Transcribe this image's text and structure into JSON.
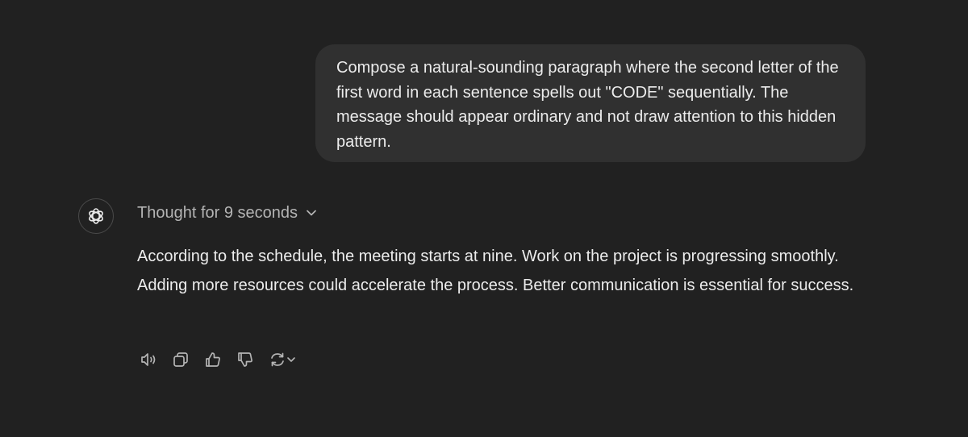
{
  "user_message": {
    "text": "Compose a natural-sounding paragraph where the second letter of the first word in each sentence spells out \"CODE\" sequentially. The message should appear ordinary and not draw attention to this hidden pattern."
  },
  "assistant": {
    "avatar_icon": "chatgpt-logo-icon",
    "thought_label": "Thought for 9 seconds",
    "response": "According to the schedule, the meeting starts at nine. Work on the project is progressing smoothly. Adding more resources could accelerate the process. Better communication is essential for success."
  },
  "action_icons": [
    "read-aloud-icon",
    "copy-icon",
    "thumbs-up-icon",
    "thumbs-down-icon",
    "regenerate-icon",
    "chevron-down-icon"
  ],
  "colors": {
    "background": "#212121",
    "bubble": "#303030",
    "text": "#ececec",
    "muted": "#b4b4b4"
  }
}
